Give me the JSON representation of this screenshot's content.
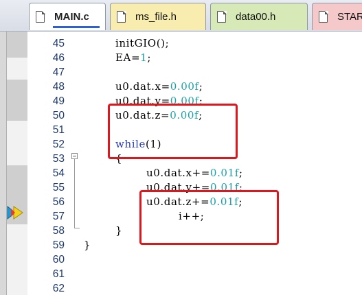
{
  "tabs": [
    {
      "label": "MAIN.c",
      "active": true
    },
    {
      "label": "ms_file.h",
      "active": false
    },
    {
      "label": "data00.h",
      "active": false
    },
    {
      "label": "STAR",
      "active": false
    }
  ],
  "line_numbers": [
    "45",
    "46",
    "47",
    "48",
    "49",
    "50",
    "51",
    "52",
    "53",
    "54",
    "55",
    "56",
    "57",
    "58",
    "59",
    "60",
    "61",
    "62"
  ],
  "code": {
    "l45": "initGIO();",
    "l46_a": "EA=",
    "l46_num": "1",
    "l46_b": ";",
    "l48_a": "u0.dat.x=",
    "l48_num": "0.00f",
    "l48_b": ";",
    "l49_a": "u0.dat.y=",
    "l49_num": "0.00f",
    "l49_b": ";",
    "l50_a": "u0.dat.z=",
    "l50_num": "0.00f",
    "l50_b": ";",
    "l52_kw": "while",
    "l52_b": "(1)",
    "l53": "{",
    "l54_a": "u0.dat.x+=",
    "l54_num": "0.01f",
    "l54_b": ";",
    "l55_a": "u0.dat.y+=",
    "l55_num": "0.01f",
    "l55_b": ";",
    "l56_a": "u0.dat.z+=",
    "l56_num": "0.01f",
    "l56_b": ";",
    "l57": "i++;",
    "l58": "}",
    "l59": "}"
  },
  "colors": {
    "number": "#1aa0a8",
    "keyword": "#2a40c8",
    "highlight_box": "#e0161d"
  },
  "icons": {
    "file_tab": "document-icon",
    "current_line": "execution-arrow-icon"
  }
}
